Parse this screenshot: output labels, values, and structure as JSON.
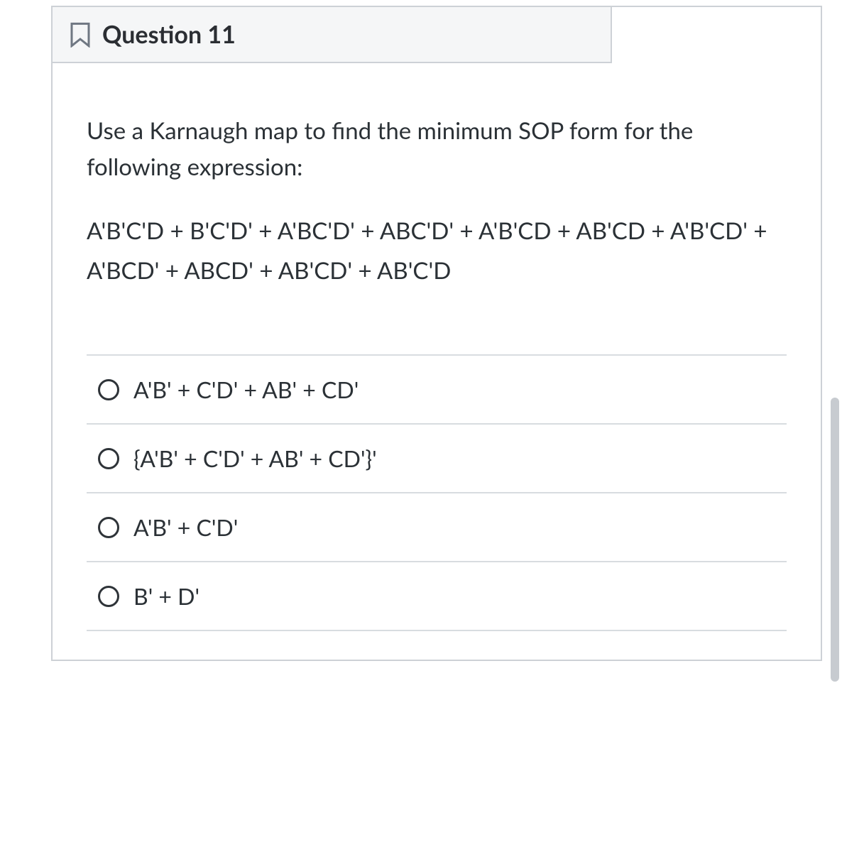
{
  "question": {
    "title": "Question 11",
    "prompt": "Use a Karnaugh map to find the minimum SOP form for the following expression:",
    "expression": "A'B'C'D + B'C'D' + A'BC'D' + ABC'D' + A'B'CD + AB'CD + A'B'CD' + A'BCD' + ABCD' + AB'CD' + AB'C'D",
    "options": [
      "A'B' + C'D' + AB' + CD'",
      "{A'B' + C'D' + AB' + CD'}'",
      "A'B' + C'D'",
      "B' + D'"
    ]
  }
}
